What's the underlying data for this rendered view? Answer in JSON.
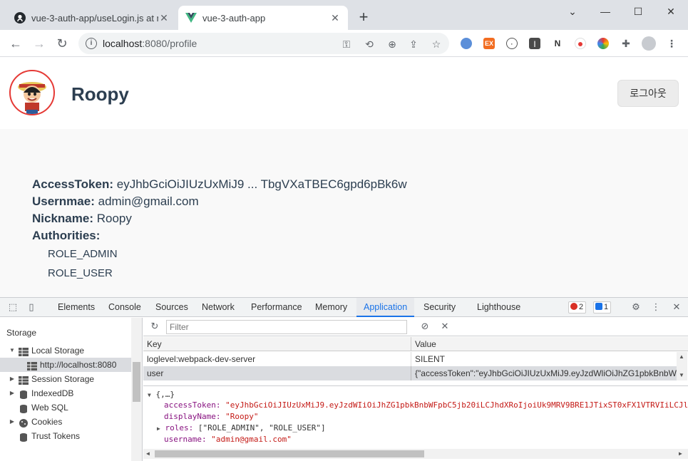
{
  "browser": {
    "tabs": [
      {
        "title": "vue-3-auth-app/useLogin.js at m",
        "active": false,
        "icon": "github-icon"
      },
      {
        "title": "vue-3-auth-app",
        "active": true,
        "icon": "vue-icon"
      }
    ],
    "new_tab_label": "+",
    "url_host": "localhost",
    "url_rest": ":8080/profile"
  },
  "page": {
    "name": "Roopy",
    "logout_label": "로그아웃",
    "access_token_label": "AccessToken:",
    "access_token_value": "eyJhbGciOiJIUzUxMiJ9 ... TbgVXaTBEC6gpd6pBk6w",
    "username_label": "Usernmae:",
    "username_value": "admin@gmail.com",
    "nickname_label": "Nickname:",
    "nickname_value": "Roopy",
    "authorities_label": "Authorities:",
    "roles": [
      "ROLE_ADMIN",
      "ROLE_USER"
    ]
  },
  "devtools": {
    "tabs": [
      "Elements",
      "Console",
      "Sources",
      "Network",
      "Performance",
      "Memory",
      "Application",
      "Security",
      "Lighthouse"
    ],
    "active_tab": "Application",
    "error_count": "2",
    "message_count": "1",
    "sidebar": {
      "heading": "Storage",
      "items": [
        {
          "label": "Local Storage"
        },
        {
          "label": "http://localhost:8080"
        },
        {
          "label": "Session Storage"
        },
        {
          "label": "IndexedDB"
        },
        {
          "label": "Web SQL"
        },
        {
          "label": "Cookies"
        },
        {
          "label": "Trust Tokens"
        }
      ]
    },
    "filter_placeholder": "Filter",
    "table": {
      "headers": [
        "Key",
        "Value"
      ],
      "rows": [
        {
          "key": "loglevel:webpack-dev-server",
          "value": "SILENT"
        },
        {
          "key": "user",
          "value": "{\"accessToken\":\"eyJhbGciOiJIUzUxMiJ9.eyJzdWliOiJhZG1pbkBnbWF..."
        }
      ]
    },
    "preview": {
      "root": "{,…}",
      "accessToken_key": "accessToken:",
      "accessToken_val": "\"eyJhbGciOiJIUzUxMiJ9.eyJzdWIiOiJhZG1pbkBnbWFpbC5jb20iLCJhdXRoIjoiUk9MRV9BRE1JTixST0xFX1VTRVIiLCJl",
      "displayName_key": "displayName:",
      "displayName_val": "\"Roopy\"",
      "roles_key": "roles:",
      "roles_val": "[\"ROLE_ADMIN\", \"ROLE_USER\"]",
      "username_key": "username:",
      "username_val": "\"admin@gmail.com\""
    }
  },
  "colors": {
    "accent": "#1a73e8",
    "page_text": "#2c3e50",
    "devtools_key": "#881280",
    "devtools_string": "#c41a16"
  }
}
